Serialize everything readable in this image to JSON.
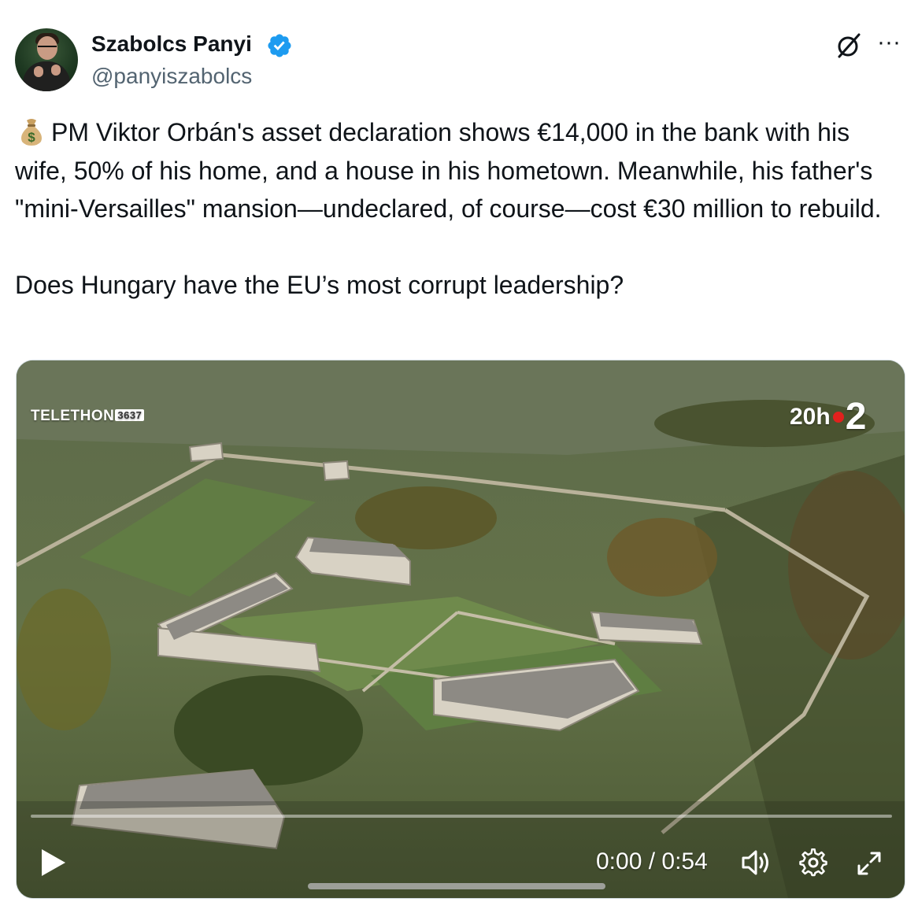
{
  "author": {
    "name": "Szabolcs Panyi",
    "handle": "@panyiszabolcs",
    "verified": true
  },
  "header_icons": [
    "grok-icon",
    "more-icon"
  ],
  "tweet": {
    "emoji": "money-bag",
    "text": "PM Viktor Orbán's asset declaration shows €14,000 in the bank with his wife, 50% of his home, and a house in his hometown. Meanwhile, his father's \"mini-Versailles\" mansion—undeclared, of course—cost €30 million to rebuild.\n\nDoes Hungary have the EU’s most corrupt leadership?"
  },
  "video": {
    "overlay_left": "TELETHON",
    "overlay_left_number": "3637",
    "overlay_right_time": "20h",
    "overlay_right_channel": "2",
    "time_display": "0:00 / 0:54",
    "progress": 0,
    "controls": [
      "play-icon",
      "volume-icon",
      "settings-icon",
      "fullscreen-icon"
    ]
  },
  "colors": {
    "text": "#0f1419",
    "secondary": "#536471",
    "verified": "#1d9bf0",
    "border": "#cfd9de"
  }
}
